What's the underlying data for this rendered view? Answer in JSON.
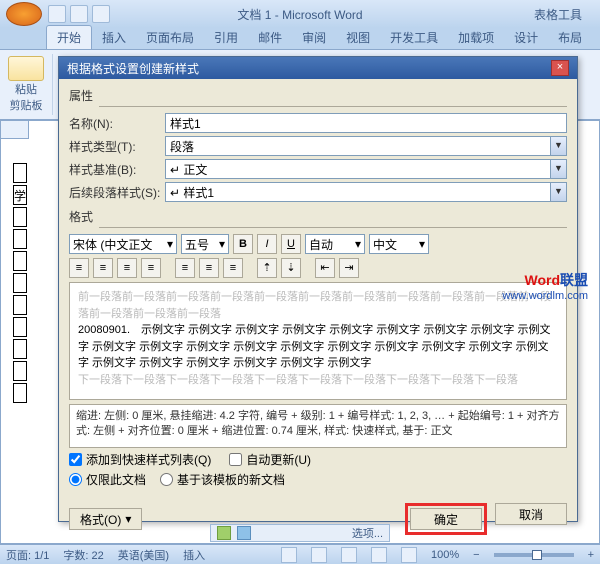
{
  "title": "文档 1 - Microsoft Word",
  "tabTool": "表格工具",
  "ribbon": {
    "tabs": [
      "开始",
      "插入",
      "页面布局",
      "引用",
      "邮件",
      "审阅",
      "视图",
      "开发工具",
      "加载项",
      "设计",
      "布局"
    ],
    "paste": "粘贴",
    "clipboard": "剪贴板"
  },
  "dialog": {
    "title": "根据格式设置创建新样式",
    "section_props": "属性",
    "name_label": "名称(N):",
    "name_value": "样式1",
    "type_label": "样式类型(T):",
    "type_value": "段落",
    "basedon_label": "样式基准(B):",
    "basedon_value": "↵ 正文",
    "following_label": "后续段落样式(S):",
    "following_value": "↵ 样式1",
    "section_format": "格式",
    "font_name": "宋体 (中文正文",
    "font_size": "五号",
    "color_auto": "自动",
    "lang": "中文",
    "preview_gray": "前一段落前一段落前一段落前一段落前一段落前一段落前一段落前一段落前一段落前一段落前一段落前一段落前一段落前一段落",
    "preview_black": "20080901.　示例文字 示例文字 示例文字 示例文字 示例文字 示例文字 示例文字 示例文字 示例文字 示例文字 示例文字 示例文字 示例文字 示例文字 示例文字 示例文字 示例文字 示例文字 示例文字 示例文字 示例文字 示例文字 示例文字 示例文字 示例文字",
    "preview_gray2": "下一段落下一段落下一段落下一段落下一段落下一段落下一段落下一段落下一段落下一段落",
    "desc": "缩进: 左侧: 0 厘米, 悬挂缩进: 4.2 字符, 编号 + 级别: 1 + 编号样式: 1, 2, 3, … + 起始编号: 1 + 对齐方式: 左侧 + 对齐位置: 0 厘米 + 缩进位置: 0.74 厘米, 样式: 快速样式, 基于: 正文",
    "add_quick": "添加到快速样式列表(Q)",
    "auto_update": "自动更新(U)",
    "only_doc": "仅限此文档",
    "based_template": "基于该模板的新文档",
    "format_btn": "格式(O)",
    "ok": "确定",
    "cancel": "取消"
  },
  "underbar": "选项...",
  "status": {
    "page": "页面: 1/1",
    "words": "字数: 22",
    "lang": "英语(美国)",
    "insert": "插入",
    "zoom": "100%"
  },
  "watermark": {
    "brand1": "Word",
    "brand2": "联盟",
    "url": "www.wordlm.com"
  }
}
